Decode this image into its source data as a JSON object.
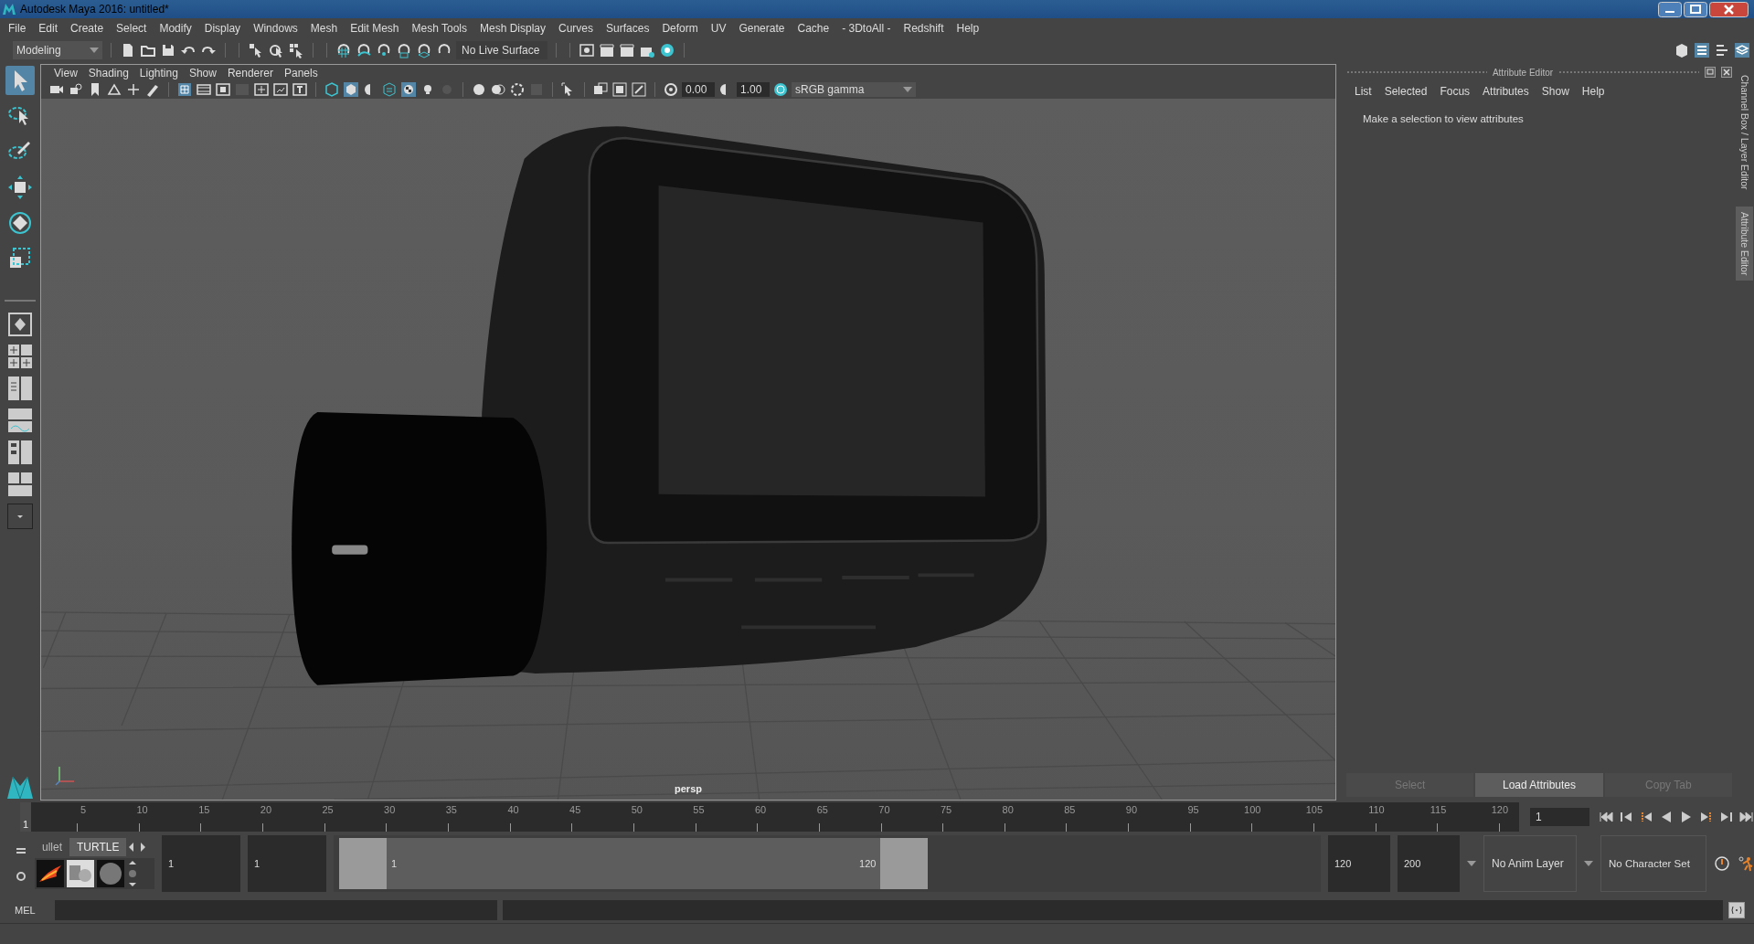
{
  "window": {
    "title": "Autodesk Maya 2016: untitled*"
  },
  "menu_bar": [
    "File",
    "Edit",
    "Create",
    "Select",
    "Modify",
    "Display",
    "Windows",
    "Mesh",
    "Edit Mesh",
    "Mesh Tools",
    "Mesh Display",
    "Curves",
    "Surfaces",
    "Deform",
    "UV",
    "Generate",
    "Cache",
    "- 3DtoAll -",
    "Redshift",
    "Help"
  ],
  "status_line": {
    "workspace": "Modeling",
    "live_surface": "No Live Surface"
  },
  "tools": [
    {
      "kind": "select",
      "selected": true
    },
    {
      "kind": "lasso",
      "selected": false
    },
    {
      "kind": "paint",
      "selected": false
    },
    {
      "kind": "move",
      "selected": false
    },
    {
      "kind": "rotate",
      "selected": false
    },
    {
      "kind": "scale",
      "selected": false
    }
  ],
  "viewport": {
    "menus": [
      "View",
      "Shading",
      "Lighting",
      "Show",
      "Renderer",
      "Panels"
    ],
    "exposure": "0.00",
    "gamma": "1.00",
    "color_space": "sRGB gamma",
    "camera": "persp"
  },
  "attribute_editor": {
    "title": "Attribute Editor",
    "menus": [
      "List",
      "Selected",
      "Focus",
      "Attributes",
      "Show",
      "Help"
    ],
    "message": "Make a selection to view attributes",
    "buttons": [
      {
        "label": "Select",
        "disabled": true
      },
      {
        "label": "Load Attributes",
        "disabled": false
      },
      {
        "label": "Copy Tab",
        "disabled": true
      }
    ]
  },
  "side_tabs": [
    {
      "label": "Channel Box / Layer Editor",
      "selected": false
    },
    {
      "label": "Attribute Editor",
      "selected": true
    }
  ],
  "time_slider": {
    "start": "1",
    "ticks": [
      "5",
      "10",
      "15",
      "20",
      "25",
      "30",
      "35",
      "40",
      "45",
      "50",
      "55",
      "60",
      "65",
      "70",
      "75",
      "80",
      "85",
      "90",
      "95",
      "100",
      "105",
      "110",
      "115",
      "120"
    ],
    "current_frame": "1",
    "level": 0
  },
  "shelf_tabs": [
    {
      "label": "ullet",
      "selected": false
    },
    {
      "label": "TURTLE",
      "selected": true
    }
  ],
  "range_slider": {
    "start_time": "1",
    "playback_start": "1",
    "range_start": "1",
    "range_end": "120",
    "playback_end": "120",
    "end_time": "200",
    "level": 0.6,
    "anim_layer": "No Anim Layer",
    "character_set": "No Character Set"
  },
  "command_line": {
    "language": "MEL"
  }
}
